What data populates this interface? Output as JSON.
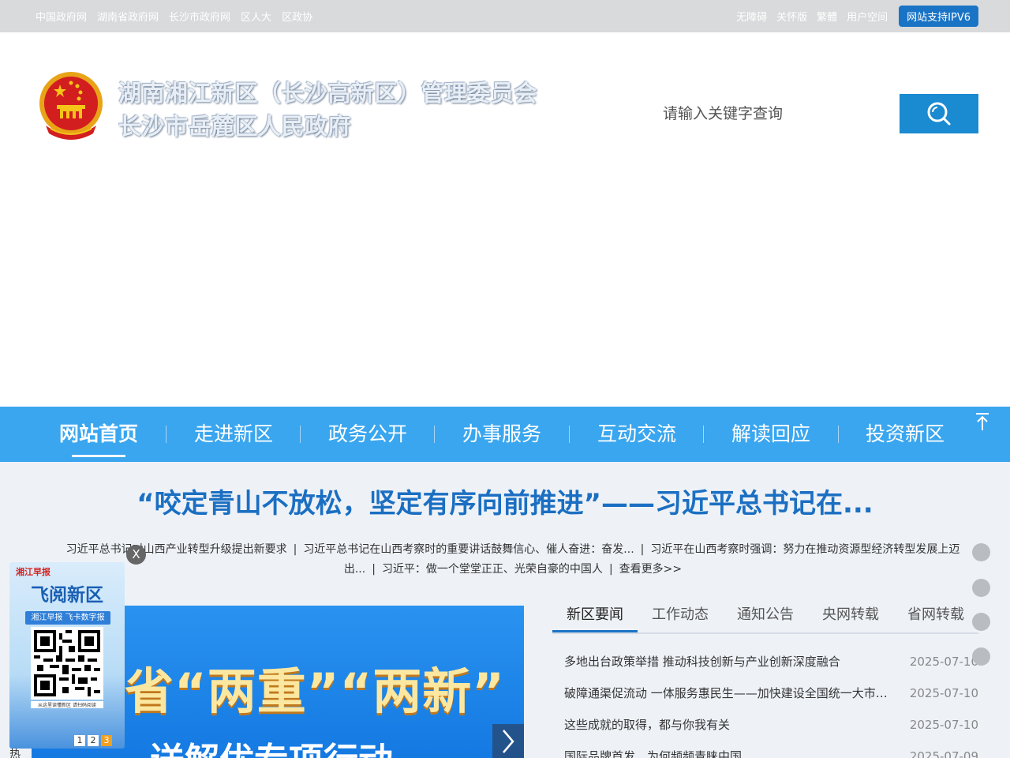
{
  "topbar": {
    "left_links": [
      "中国政府网",
      "湖南省政府网",
      "长沙市政府网",
      "区人大",
      "区政协"
    ],
    "right_links": [
      "无障碍",
      "关怀版",
      "繁體",
      "用户空间"
    ],
    "ipv6_label": "网站支持IPV6"
  },
  "header": {
    "title_line1": "湖南湘江新区（长沙高新区）管理委员会",
    "title_line2": "长沙市岳麓区人民政府",
    "search_placeholder": "请输入关键字查询"
  },
  "nav": {
    "items": [
      "网站首页",
      "走进新区",
      "政务公开",
      "办事服务",
      "互动交流",
      "解读回应",
      "投资新区"
    ],
    "active_index": 0
  },
  "headline": {
    "title": "“咬定青山不放松，坚定有序向前推进”——习近平总书记在...",
    "sub_items": [
      "习近平总书记对山西产业转型升级提出新要求",
      "习近平总书记在山西考察时的重要讲话鼓舞信心、催人奋进：奋发...",
      "习近平在山西考察时强调：努力在推动资源型经济转型发展上迈出...",
      "习近平：做一个堂堂正正、光荣自豪的中国人"
    ],
    "more": "查看更多>>"
  },
  "banner": {
    "text1": "省“两重”“两新”",
    "text2": "送解优专项行动"
  },
  "tabs": {
    "items": [
      "新区要闻",
      "工作动态",
      "通知公告",
      "央网转载",
      "省网转载"
    ],
    "active_index": 0
  },
  "news": [
    {
      "title": "多地出台政策举措 推动科技创新与产业创新深度融合",
      "date": "2025-07-10"
    },
    {
      "title": "破障通渠促流动 一体服务惠民生——加快建设全国统一大市场...",
      "date": "2025-07-10"
    },
    {
      "title": "这些成就的取得，都与你我有关",
      "date": "2025-07-10"
    },
    {
      "title": "国际品牌首发，为何频频青睐中国",
      "date": "2025-07-09"
    }
  ],
  "ad": {
    "logo": "湘江早报",
    "title": "飞阅新区",
    "subtitle": "湘江早报 飞卡数字报",
    "qr_hint": "从这里读懂新区 请扫码阅读",
    "pages": [
      "1",
      "2",
      "3"
    ],
    "active_page": 2,
    "close": "X"
  },
  "side_label": "热",
  "colors": {
    "nav_bg": "#3aa6ef",
    "headline": "#1b6fc2",
    "search_btn": "#1a8ad1",
    "ipv6_bg": "#1a74c6"
  }
}
